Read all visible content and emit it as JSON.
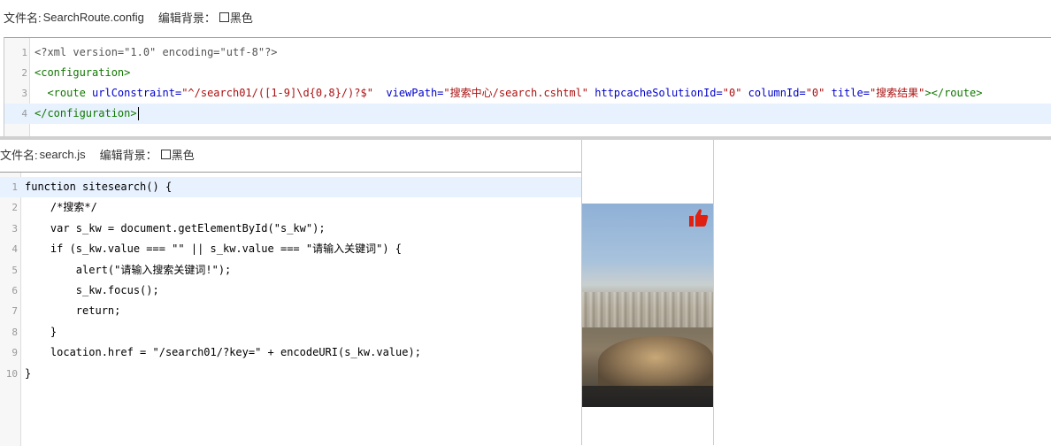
{
  "file1": {
    "label": "文件名",
    "name": "SearchRoute.config",
    "bg_label": "编辑背景：",
    "bg_option": "黑色",
    "lines": [
      {
        "num": "1",
        "tokens": [
          {
            "t": "<?xml version=\"1.0\" encoding=\"utf-8\"?>",
            "c": "meta"
          }
        ]
      },
      {
        "num": "2",
        "tokens": [
          {
            "t": "<configuration>",
            "c": "tag"
          }
        ]
      },
      {
        "num": "3",
        "tokens": [
          {
            "t": "  ",
            "c": "plain"
          },
          {
            "t": "<route",
            "c": "tag"
          },
          {
            "t": " urlConstraint=",
            "c": "attr"
          },
          {
            "t": "\"^/search01/([1-9]\\d{0,8}/)?$\"",
            "c": "str"
          },
          {
            "t": "  viewPath=",
            "c": "attr"
          },
          {
            "t": "\"搜索中心/search.cshtml\"",
            "c": "str"
          },
          {
            "t": " httpcacheSolutionId=",
            "c": "attr"
          },
          {
            "t": "\"0\"",
            "c": "str"
          },
          {
            "t": " columnId=",
            "c": "attr"
          },
          {
            "t": "\"0\"",
            "c": "str"
          },
          {
            "t": " title=",
            "c": "attr"
          },
          {
            "t": "\"搜索结果\"",
            "c": "str"
          },
          {
            "t": "></route>",
            "c": "tag"
          }
        ]
      },
      {
        "num": "4",
        "tokens": [
          {
            "t": "</configuration>",
            "c": "tag"
          }
        ]
      }
    ]
  },
  "file2": {
    "label": "文件名",
    "name": "search.js",
    "bg_label": "编辑背景：",
    "bg_option": "黑色",
    "lines": [
      {
        "num": "1",
        "text": "function sitesearch() {"
      },
      {
        "num": "2",
        "text": "    /*搜索*/"
      },
      {
        "num": "3",
        "text": "    var s_kw = document.getElementById(\"s_kw\");"
      },
      {
        "num": "4",
        "text": "    if (s_kw.value === \"\" || s_kw.value === \"请输入关键词\") {"
      },
      {
        "num": "5",
        "text": "        alert(\"请输入搜索关键词!\");"
      },
      {
        "num": "6",
        "text": "        s_kw.focus();"
      },
      {
        "num": "7",
        "text": "        return;"
      },
      {
        "num": "8",
        "text": "    }"
      },
      {
        "num": "9",
        "text": "    location.href = \"/search01/?key=\" + encodeURI(s_kw.value);"
      },
      {
        "num": "10",
        "text": "}"
      }
    ]
  },
  "photo": {
    "description_icon": "thumbs-up-icon",
    "icon_color": "#e02010"
  },
  "colors": {
    "active_line": "#e8f2ff",
    "tag": "#117700",
    "attr": "#0000cc",
    "string": "#aa1111"
  }
}
